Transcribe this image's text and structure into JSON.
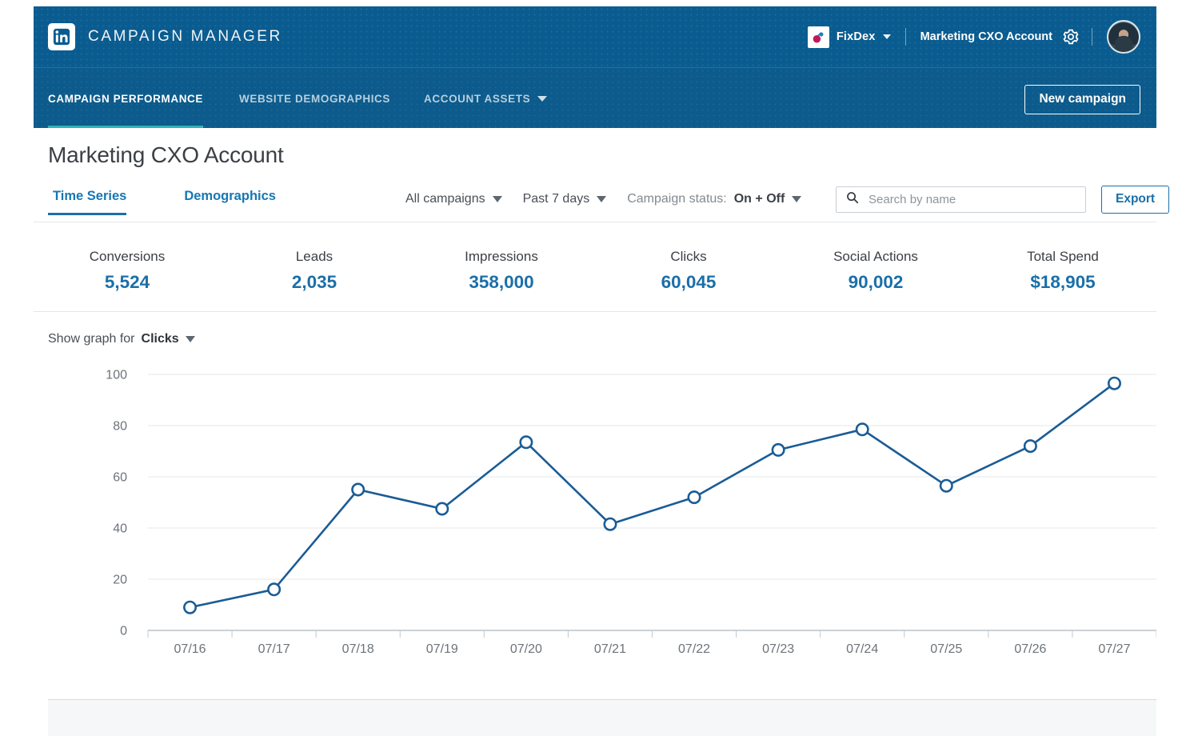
{
  "header": {
    "logo_icon": "linkedin-logo-icon",
    "product_title": "CAMPAIGN MANAGER",
    "advertiser_logo_icon": "fixdex-logo-icon",
    "advertiser_name": "FixDex",
    "account_name": "Marketing CXO Account",
    "settings_icon": "gear-icon",
    "avatar_icon": "user-avatar"
  },
  "nav": {
    "items": [
      {
        "label": "CAMPAIGN PERFORMANCE",
        "active": true,
        "has_caret": false
      },
      {
        "label": "WEBSITE DEMOGRAPHICS",
        "active": false,
        "has_caret": false
      },
      {
        "label": "ACCOUNT ASSETS",
        "active": false,
        "has_caret": true
      }
    ],
    "new_campaign_label": "New campaign",
    "active_underline_color": "#2fb3b8"
  },
  "page": {
    "title": "Marketing CXO Account",
    "subtabs": [
      {
        "label": "Time Series",
        "active": true
      },
      {
        "label": "Demographics",
        "active": false
      }
    ],
    "accent_color": "#1a6fa8"
  },
  "filters": {
    "campaigns": "All campaigns",
    "date_range": "Past 7 days",
    "status_label": "Campaign status:",
    "status_value": "On + Off",
    "search_icon": "search-icon",
    "search_value": "",
    "search_placeholder": "Search by name",
    "export_label": "Export"
  },
  "metrics": [
    {
      "label": "Conversions",
      "value": "5,524"
    },
    {
      "label": "Leads",
      "value": "2,035"
    },
    {
      "label": "Impressions",
      "value": "358,000"
    },
    {
      "label": "Clicks",
      "value": "60,045"
    },
    {
      "label": "Social Actions",
      "value": "90,002"
    },
    {
      "label": "Total Spend",
      "value": "$18,905"
    }
  ],
  "graph_selector": {
    "prefix": "Show graph for",
    "metric": "Clicks"
  },
  "chart_data": {
    "type": "line",
    "title": "",
    "xlabel": "",
    "ylabel": "",
    "categories": [
      "07/16",
      "07/17",
      "07/18",
      "07/19",
      "07/20",
      "07/21",
      "07/22",
      "07/23",
      "07/24",
      "07/25",
      "07/26",
      "07/27"
    ],
    "series": [
      {
        "name": "Clicks",
        "values": [
          9,
          16,
          55,
          47.5,
          73.5,
          41.5,
          52,
          70.5,
          78.5,
          56.5,
          72,
          96.5
        ],
        "color": "#1a5c96"
      }
    ],
    "ylim": [
      0,
      100
    ],
    "yticks": [
      0,
      20,
      40,
      60,
      80,
      100
    ],
    "ytick_labels": [
      "0",
      "20",
      "40",
      "60",
      "80",
      "100"
    ],
    "grid": true,
    "legend": false,
    "marker": "open-circle",
    "marker_fill": "#ffffff"
  }
}
